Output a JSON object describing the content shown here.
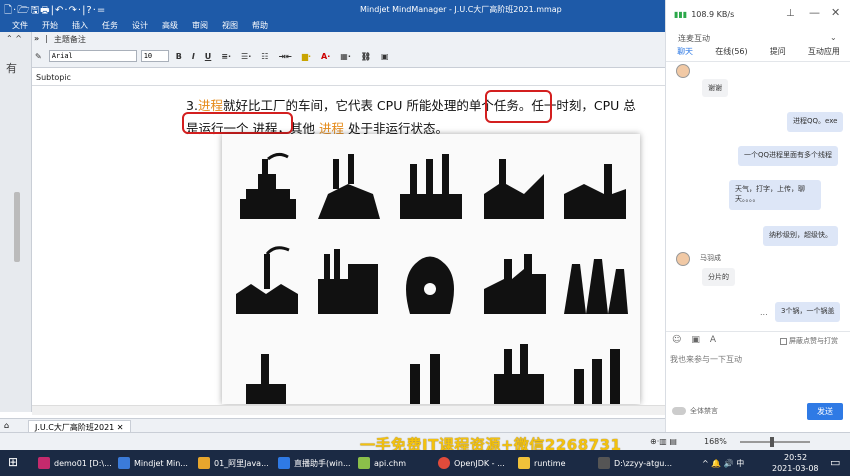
{
  "window": {
    "title": "Mindjet MindManager - J.U.C大厂高阶班2021.mmap",
    "quick_access": "🗋·🗁🖫🖶|↶·↷·|?·="
  },
  "menu": [
    "文件",
    "开始",
    "插入",
    "任务",
    "设计",
    "高级",
    "审阅",
    "视图",
    "帮助"
  ],
  "format_panel": {
    "title": "主题备注",
    "font_name": "Arial",
    "font_size": "10",
    "bold": "B",
    "italic": "I",
    "underline": "U"
  },
  "topic": {
    "label": "Subtopic"
  },
  "slide": {
    "line1_prefix": "3.",
    "line1_hl": "进程",
    "line1_mid": "就好比工厂的车间，它代表 CPU 所能处理的",
    "line1_boxed": "单个任务。",
    "line1_suffix": "任一时刻，CPU 总",
    "line2_boxed": "是运行一个 进程，",
    "line2_mid": "其他 ",
    "line2_hl": "进程",
    "line2_suffix": " 处于非运行状态。"
  },
  "tab": {
    "name": "J.U.C大厂高阶班2021"
  },
  "statusbar": {
    "zoom": "168%"
  },
  "watermark": "一手免费IT课程资源+微信2268731",
  "chat": {
    "network": "108.9 KB/s",
    "section_label": "连麦互动",
    "tabs": [
      "聊天",
      "在线(56)",
      "提问",
      "互动应用"
    ],
    "messages": [
      {
        "side": "left",
        "text": "谢谢"
      },
      {
        "side": "right",
        "text": "进程QQ。exe"
      },
      {
        "side": "right",
        "text": "一个QQ进程里面有多个线程"
      },
      {
        "side": "right",
        "text": "天气，打字，上传，聊天。。。。"
      },
      {
        "side": "right",
        "text": "纳秒级别，超级快。"
      },
      {
        "side": "left",
        "name": "马羽成",
        "text": "分片的"
      },
      {
        "side": "right",
        "text": "3个锅，一个锅盖"
      }
    ],
    "mute_label": "屏蔽点赞与打赏",
    "input_placeholder": "我也来参与一下互动",
    "mute_all": "全体禁言",
    "send": "发送",
    "more": "..."
  },
  "taskbar": {
    "items": [
      "demo01 [D:\\...",
      "Mindjet Min...",
      "01_阿里Java...",
      "直播助手(win...",
      "api.chm",
      "OpenJDK - ...",
      "runtime",
      "D:\\zzyy-atgu..."
    ],
    "time": "20:52",
    "date": "2021-03-08",
    "tray": "^ 🔔 🔊 中"
  },
  "colors": {
    "accent": "#1e5aa8",
    "highlight": "#e58b1a",
    "box": "#d31f1f",
    "send": "#2f7ae5"
  }
}
